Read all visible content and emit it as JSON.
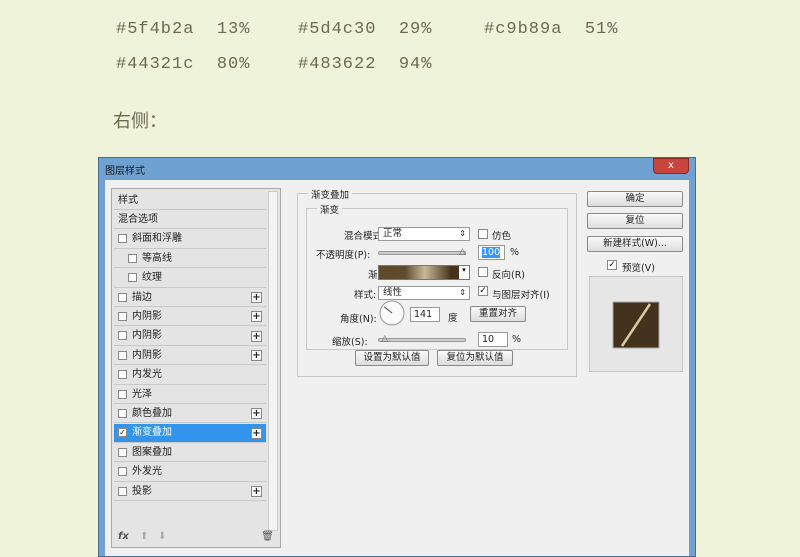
{
  "notes": {
    "colors": [
      {
        "hex": "#5f4b2a",
        "pos": "13%"
      },
      {
        "hex": "#5d4c30",
        "pos": "29%"
      },
      {
        "hex": "#c9b89a",
        "pos": "51%"
      },
      {
        "hex": "#44321c",
        "pos": "80%"
      },
      {
        "hex": "#483622",
        "pos": "94%"
      }
    ],
    "right_side": "右侧："
  },
  "dialog": {
    "title": "图层样式",
    "close": "x",
    "styles": [
      {
        "label": "样式",
        "checkbox": false,
        "plus": false,
        "indent": false,
        "checked": false
      },
      {
        "label": "混合选项",
        "checkbox": false,
        "plus": false,
        "indent": false,
        "checked": false
      },
      {
        "label": "斜面和浮雕",
        "checkbox": true,
        "plus": false,
        "indent": false,
        "checked": false
      },
      {
        "label": "等高线",
        "checkbox": true,
        "plus": false,
        "indent": true,
        "checked": false
      },
      {
        "label": "纹理",
        "checkbox": true,
        "plus": false,
        "indent": true,
        "checked": false
      },
      {
        "label": "描边",
        "checkbox": true,
        "plus": true,
        "indent": false,
        "checked": false
      },
      {
        "label": "内阴影",
        "checkbox": true,
        "plus": true,
        "indent": false,
        "checked": false
      },
      {
        "label": "内阴影",
        "checkbox": true,
        "plus": true,
        "indent": false,
        "checked": false
      },
      {
        "label": "内阴影",
        "checkbox": true,
        "plus": true,
        "indent": false,
        "checked": false
      },
      {
        "label": "内发光",
        "checkbox": true,
        "plus": false,
        "indent": false,
        "checked": false
      },
      {
        "label": "光泽",
        "checkbox": true,
        "plus": false,
        "indent": false,
        "checked": false
      },
      {
        "label": "颜色叠加",
        "checkbox": true,
        "plus": true,
        "indent": false,
        "checked": false
      },
      {
        "label": "渐变叠加",
        "checkbox": true,
        "plus": true,
        "indent": false,
        "checked": true,
        "selected": true
      },
      {
        "label": "图案叠加",
        "checkbox": true,
        "plus": false,
        "indent": false,
        "checked": false
      },
      {
        "label": "外发光",
        "checkbox": true,
        "plus": false,
        "indent": false,
        "checked": false
      },
      {
        "label": "投影",
        "checkbox": true,
        "plus": true,
        "indent": false,
        "checked": false
      }
    ],
    "footer": {
      "fx": "fx"
    },
    "panel": {
      "group_title": "渐变叠加",
      "sub_title": "渐变",
      "blend_label": "混合模式:",
      "blend_value": "正常",
      "dither_label": "仿色",
      "opacity_label": "不透明度(P):",
      "opacity_value": "100",
      "opacity_percent": 100,
      "percent": "%",
      "gradient_label": "渐变:",
      "reverse_label": "反向(R)",
      "style_label": "样式:",
      "style_value": "线性",
      "align_label": "与图层对齐(I)",
      "angle_label": "角度(N):",
      "angle_value": "141",
      "degree": "度",
      "reset_align": "重置对齐",
      "scale_label": "缩放(S):",
      "scale_value": "10",
      "scale_percent": 10,
      "set_default": "设置为默认值",
      "reset_default": "复位为默认值"
    },
    "buttons": {
      "ok": "确定",
      "reset": "复位",
      "new_style": "新建样式(W)...",
      "preview": "预览(V)"
    }
  }
}
